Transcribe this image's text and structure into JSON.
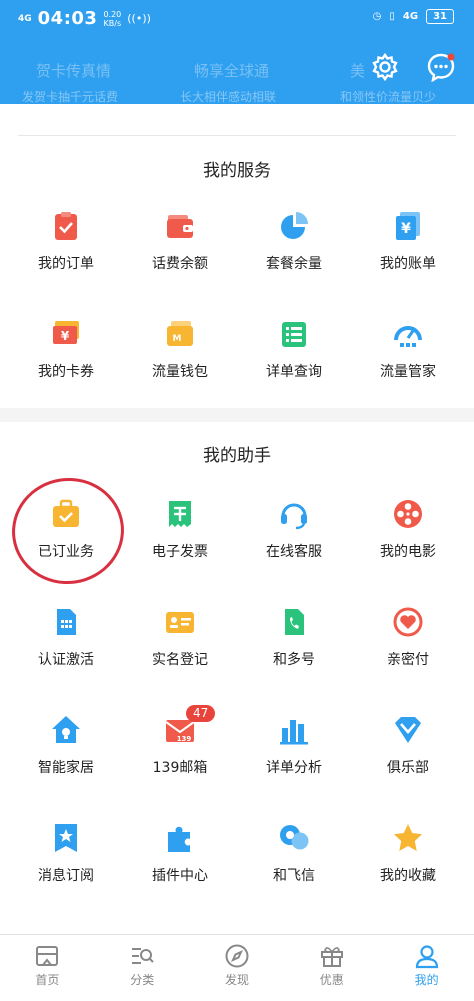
{
  "status_bar": {
    "signal": "4G",
    "time": "04:03",
    "speed_value": "0.20",
    "speed_unit": "KB/s",
    "network": "4G",
    "battery": "31"
  },
  "header": {
    "ghost_titles": [
      "贺卡传真情",
      "畅享全球通",
      "美"
    ],
    "ghost_subtitles": [
      "发贺卡抽千元话费",
      "长大相伴感动相联",
      "和领性价流量贝少"
    ]
  },
  "services": {
    "title": "我的服务",
    "items": [
      {
        "label": "我的订单",
        "icon": "order-icon"
      },
      {
        "label": "话费余额",
        "icon": "wallet-icon"
      },
      {
        "label": "套餐余量",
        "icon": "pie-chart-icon"
      },
      {
        "label": "我的账单",
        "icon": "bill-icon"
      },
      {
        "label": "我的卡券",
        "icon": "coupon-icon"
      },
      {
        "label": "流量钱包",
        "icon": "data-wallet-icon"
      },
      {
        "label": "详单查询",
        "icon": "list-icon"
      },
      {
        "label": "流量管家",
        "icon": "gauge-icon"
      }
    ]
  },
  "assistant": {
    "title": "我的助手",
    "items": [
      {
        "label": "已订业务",
        "icon": "briefcase-icon"
      },
      {
        "label": "电子发票",
        "icon": "invoice-icon"
      },
      {
        "label": "在线客服",
        "icon": "headset-icon"
      },
      {
        "label": "我的电影",
        "icon": "film-reel-icon"
      },
      {
        "label": "认证激活",
        "icon": "sim-card-icon"
      },
      {
        "label": "实名登记",
        "icon": "id-card-icon"
      },
      {
        "label": "和多号",
        "icon": "multi-number-icon"
      },
      {
        "label": "亲密付",
        "icon": "heart-pay-icon"
      },
      {
        "label": "智能家居",
        "icon": "smart-home-icon"
      },
      {
        "label": "139邮箱",
        "icon": "mail-icon"
      },
      {
        "label": "详单分析",
        "icon": "bar-chart-icon"
      },
      {
        "label": "俱乐部",
        "icon": "diamond-icon"
      },
      {
        "label": "消息订阅",
        "icon": "subscribe-icon"
      },
      {
        "label": "插件中心",
        "icon": "puzzle-icon"
      },
      {
        "label": "和飞信",
        "icon": "chat-bubbles-icon"
      },
      {
        "label": "我的收藏",
        "icon": "star-icon"
      }
    ],
    "mail_badge": "47"
  },
  "colors": {
    "primary": "#2f9ff0",
    "red": "#f05a4a",
    "orange": "#f7b531",
    "green": "#2bc27b",
    "annotation": "#d83040"
  },
  "tabbar": {
    "items": [
      {
        "label": "首页",
        "icon": "home-icon"
      },
      {
        "label": "分类",
        "icon": "category-icon"
      },
      {
        "label": "发现",
        "icon": "compass-icon"
      },
      {
        "label": "优惠",
        "icon": "gift-icon"
      },
      {
        "label": "我的",
        "icon": "user-icon"
      }
    ],
    "active": "我的"
  }
}
